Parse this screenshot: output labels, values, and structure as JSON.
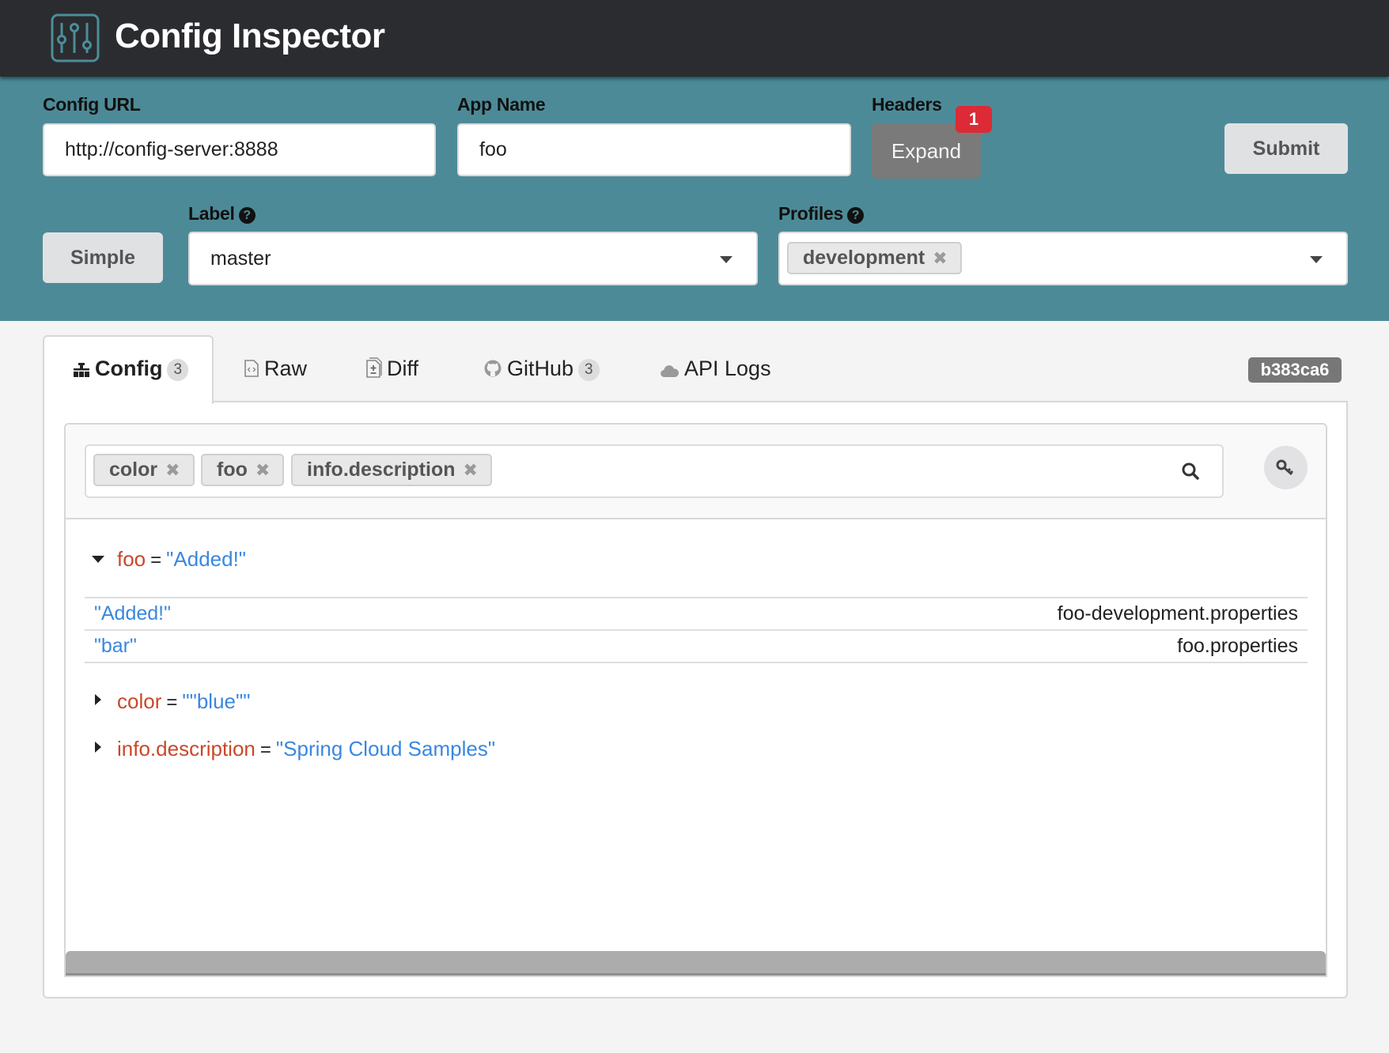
{
  "app": {
    "title": "Config Inspector",
    "logo_icon": "sliders-icon"
  },
  "form": {
    "config_url": {
      "label": "Config URL",
      "value": "http://config-server:8888"
    },
    "app_name": {
      "label": "App Name",
      "value": "foo"
    },
    "headers": {
      "label": "Headers",
      "button_label": "Expand",
      "badge_count": "1"
    },
    "submit_label": "Submit",
    "mode_button_label": "Simple",
    "label_field": {
      "label": "Label",
      "help_icon": "question-circle-icon",
      "selected": "master"
    },
    "profiles_field": {
      "label": "Profiles",
      "help_icon": "question-circle-icon",
      "selected_chips": [
        "development"
      ]
    }
  },
  "tabs": [
    {
      "label": "Config",
      "icon": "sitemap-icon",
      "count": "3",
      "active": true
    },
    {
      "label": "Raw",
      "icon": "file-code-icon",
      "active": false
    },
    {
      "label": "Diff",
      "icon": "file-diff-icon",
      "active": false
    },
    {
      "label": "GitHub",
      "icon": "github-icon",
      "count": "3",
      "active": false
    },
    {
      "label": "API Logs",
      "icon": "cloud-icon",
      "active": false
    }
  ],
  "commit_badge": "b383ca6",
  "filter": {
    "chips": [
      "color",
      "foo",
      "info.description"
    ],
    "remove_glyph": "✖"
  },
  "properties": [
    {
      "key": "foo",
      "value": "\"Added!\"",
      "expanded": true,
      "sources": [
        {
          "value": "\"Added!\"",
          "source": "foo-development.properties"
        },
        {
          "value": "\"bar\"",
          "source": "foo.properties"
        }
      ]
    },
    {
      "key": "color",
      "value": "\"\"blue\"\"",
      "expanded": false
    },
    {
      "key": "info.description",
      "value": "\"Spring Cloud Samples\"",
      "expanded": false
    }
  ],
  "colors": {
    "topbar": "#2b2c2f",
    "form_bg": "#4d8a97",
    "key": "#c9482a",
    "string": "#3a87e0",
    "notification": "#dc2a36"
  }
}
